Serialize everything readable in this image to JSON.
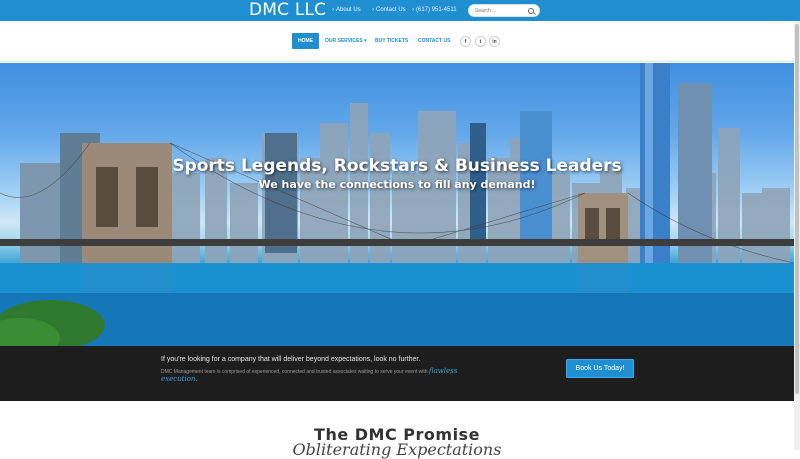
{
  "topbar": {
    "brand": "DMC LLC",
    "links": [
      {
        "label": "About Us"
      },
      {
        "label": "Contact Us"
      },
      {
        "label": "(617) 951-4511"
      }
    ],
    "search_placeholder": "Search ...",
    "color": "#1f8fd2"
  },
  "nav": {
    "items": [
      {
        "label": "HOME",
        "active": true
      },
      {
        "label": "OUR SERVICES ▾",
        "active": false
      },
      {
        "label": "BUY TICKETS",
        "active": false
      },
      {
        "label": "CONTACT US",
        "active": false
      }
    ],
    "social": [
      {
        "icon": "facebook-icon",
        "glyph": "f"
      },
      {
        "icon": "twitter-icon",
        "glyph": "t"
      },
      {
        "icon": "linkedin-icon",
        "glyph": "in"
      }
    ]
  },
  "hero": {
    "title": "Sports Legends, Rockstars & Business Leaders",
    "subtitle": "We have the connections to fill any demand!"
  },
  "cta": {
    "line1": "If you're looking for a company that will deliver beyond expectations, look no further.",
    "line2": "DMC Management team is comprised of experienced, connected and trusted associates waiting to serve your event with",
    "emphasis": "flawless execution.",
    "button": "Book Us Today!"
  },
  "promise": {
    "title": "The DMC Promise",
    "subtitle": "Obliterating Expectations"
  }
}
